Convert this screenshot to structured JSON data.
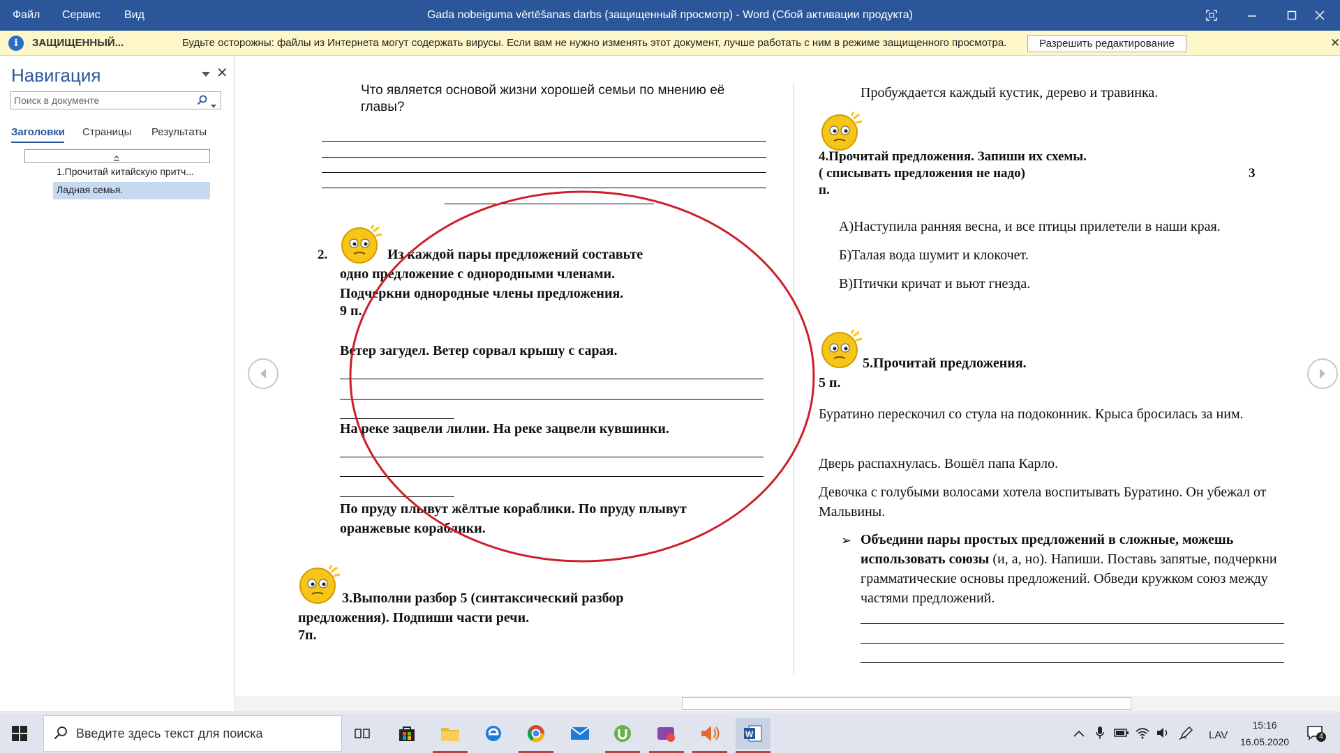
{
  "titlebar": {
    "menu": [
      "Файл",
      "Сервис",
      "Вид"
    ],
    "title": "Gada nobeiguma vērtēšanas darbs (защищенный просмотр) - Word (Сбой активации продукта)"
  },
  "protected_bar": {
    "label": "ЗАЩИЩЕННЫЙ...",
    "message": "Будьте осторожны: файлы из Интернета могут содержать вирусы. Если вам не нужно изменять этот документ, лучше работать с ним в режиме защищенного просмотра.",
    "button": "Разрешить редактирование"
  },
  "nav": {
    "title": "Навигация",
    "search_placeholder": "Поиск в документе",
    "tabs": [
      "Заголовки",
      "Страницы",
      "Результаты"
    ],
    "items": [
      "1.Прочитай  китайскую притч...",
      "Ладная семья."
    ]
  },
  "left_page": {
    "question": "Что является основой жизни хорошей семьи по мнению её главы?",
    "task2_number": "2.",
    "task2_text": "Из каждой пары предложений  составьте  одно предложение с однородными членами. Подчеркни однородные члены предложения.",
    "task2_points": "9 п.",
    "pairs": [
      "Ветер загудел. Ветер сорвал крышу с сарая.",
      "На реке зацвели лилии. На реке зацвели кувшинки.",
      "По пруду плывут жёлтые кораблики. По пруду плывут оранжевые кораблики."
    ],
    "task3_text": "3.Выполни разбор 5 (синтаксический  разбор предложения). Подпиши части речи.",
    "task3_points": "7п."
  },
  "right_page": {
    "top_line": "Пробуждается каждый кустик, дерево и травинка.",
    "task4_title": "4.Прочитай предложения. Запиши их схемы.",
    "task4_sub": "( списывать предложения не надо)",
    "task4_points_num": "3",
    "task4_points_unit": "п.",
    "sentences": [
      "А)Наступила ранняя весна, и все птицы прилетели в наши края.",
      "Б)Талая вода шумит и клокочет.",
      "В)Птички кричат и вьют гнезда."
    ],
    "task5_title": "5.Прочитай предложения.",
    "task5_points": "5 п.",
    "paragraphs": [
      "Буратино   перескочил со стула на подоконник. Крыса бросилась за ним.",
      "Дверь распахнулась. Вошёл папа Карло.",
      "Девочка с голубыми волосами хотела воспитывать Буратино. Он убежал от Мальвины."
    ],
    "bullet_bold": "Объедини пары простых предложений в сложные, можешь использовать союзы",
    "bullet_rest": " (и, а, но). Напиши. Поставь запятые, подчеркни грамматические основы предложений. Обведи кружком союз между частями предложений."
  },
  "taskbar": {
    "search_placeholder": "Введите здесь текст для поиска",
    "lang": "LAV",
    "time": "15:16",
    "date": "16.05.2020",
    "notifications": "4"
  },
  "colors": {
    "titlebar": "#2b579a",
    "protected_bar": "#fdf6c8",
    "nav_selected": "#c5d9f1",
    "annotation_circle": "#cc1f2a"
  }
}
